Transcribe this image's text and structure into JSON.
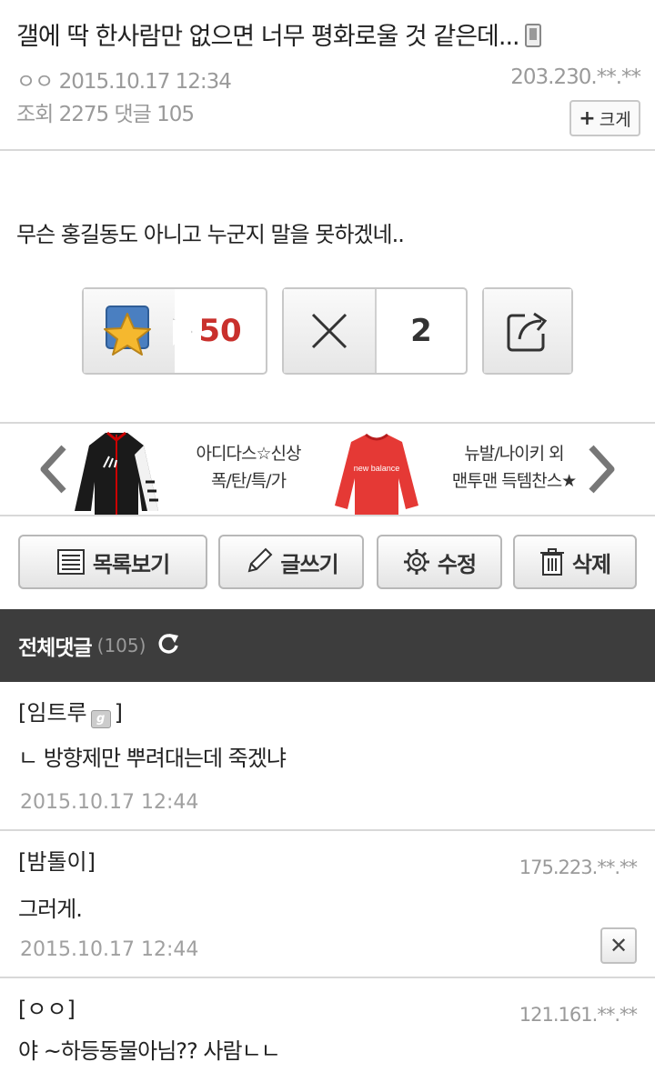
{
  "post": {
    "title": "갤에 딱 한사람만 없으면 너무 평화로울 것 같은데...",
    "author": "ㅇㅇ",
    "datetime": "2015.10.17 12:34",
    "ip": "203.230.**.**",
    "views_label": "조회",
    "views": "2275",
    "comments_label": "댓글",
    "comments": "105",
    "size_button": "크게",
    "body": "무슨 홍길동도 아니고 누군지 말을 못하겠네.."
  },
  "votes": {
    "up": "50",
    "down": "2"
  },
  "ad": {
    "item1": {
      "line1": "아디다스☆신상",
      "line2": "폭/탄/특/가"
    },
    "item2": {
      "line1": "뉴발/나이키 외",
      "line2": "맨투맨 득템찬스★"
    },
    "item2_logo": "new balance"
  },
  "actions": {
    "list": "목록보기",
    "write": "글쓰기",
    "edit": "수정",
    "delete": "삭제"
  },
  "comments_header": {
    "title": "전체댓글",
    "count": "(105)"
  },
  "comments": [
    {
      "author": "[임트루",
      "author_end": "]",
      "text": "ㄴ 방향제만 뿌려대는데 죽겠냐",
      "date": "2015.10.17 12:44",
      "ip": ""
    },
    {
      "author": "[밤톨이]",
      "text": "그러게.",
      "date": "2015.10.17 12:44",
      "ip": "175.223.**.**"
    },
    {
      "author": "[ㅇㅇ]",
      "text": "야 ~하등동물아님?? 사람ㄴㄴ",
      "date": "",
      "ip": "121.161.**.**"
    }
  ],
  "colors": {
    "vote_up": "#c9302c",
    "comment_bar": "#3d3d3d",
    "star": "#f5b82e"
  }
}
